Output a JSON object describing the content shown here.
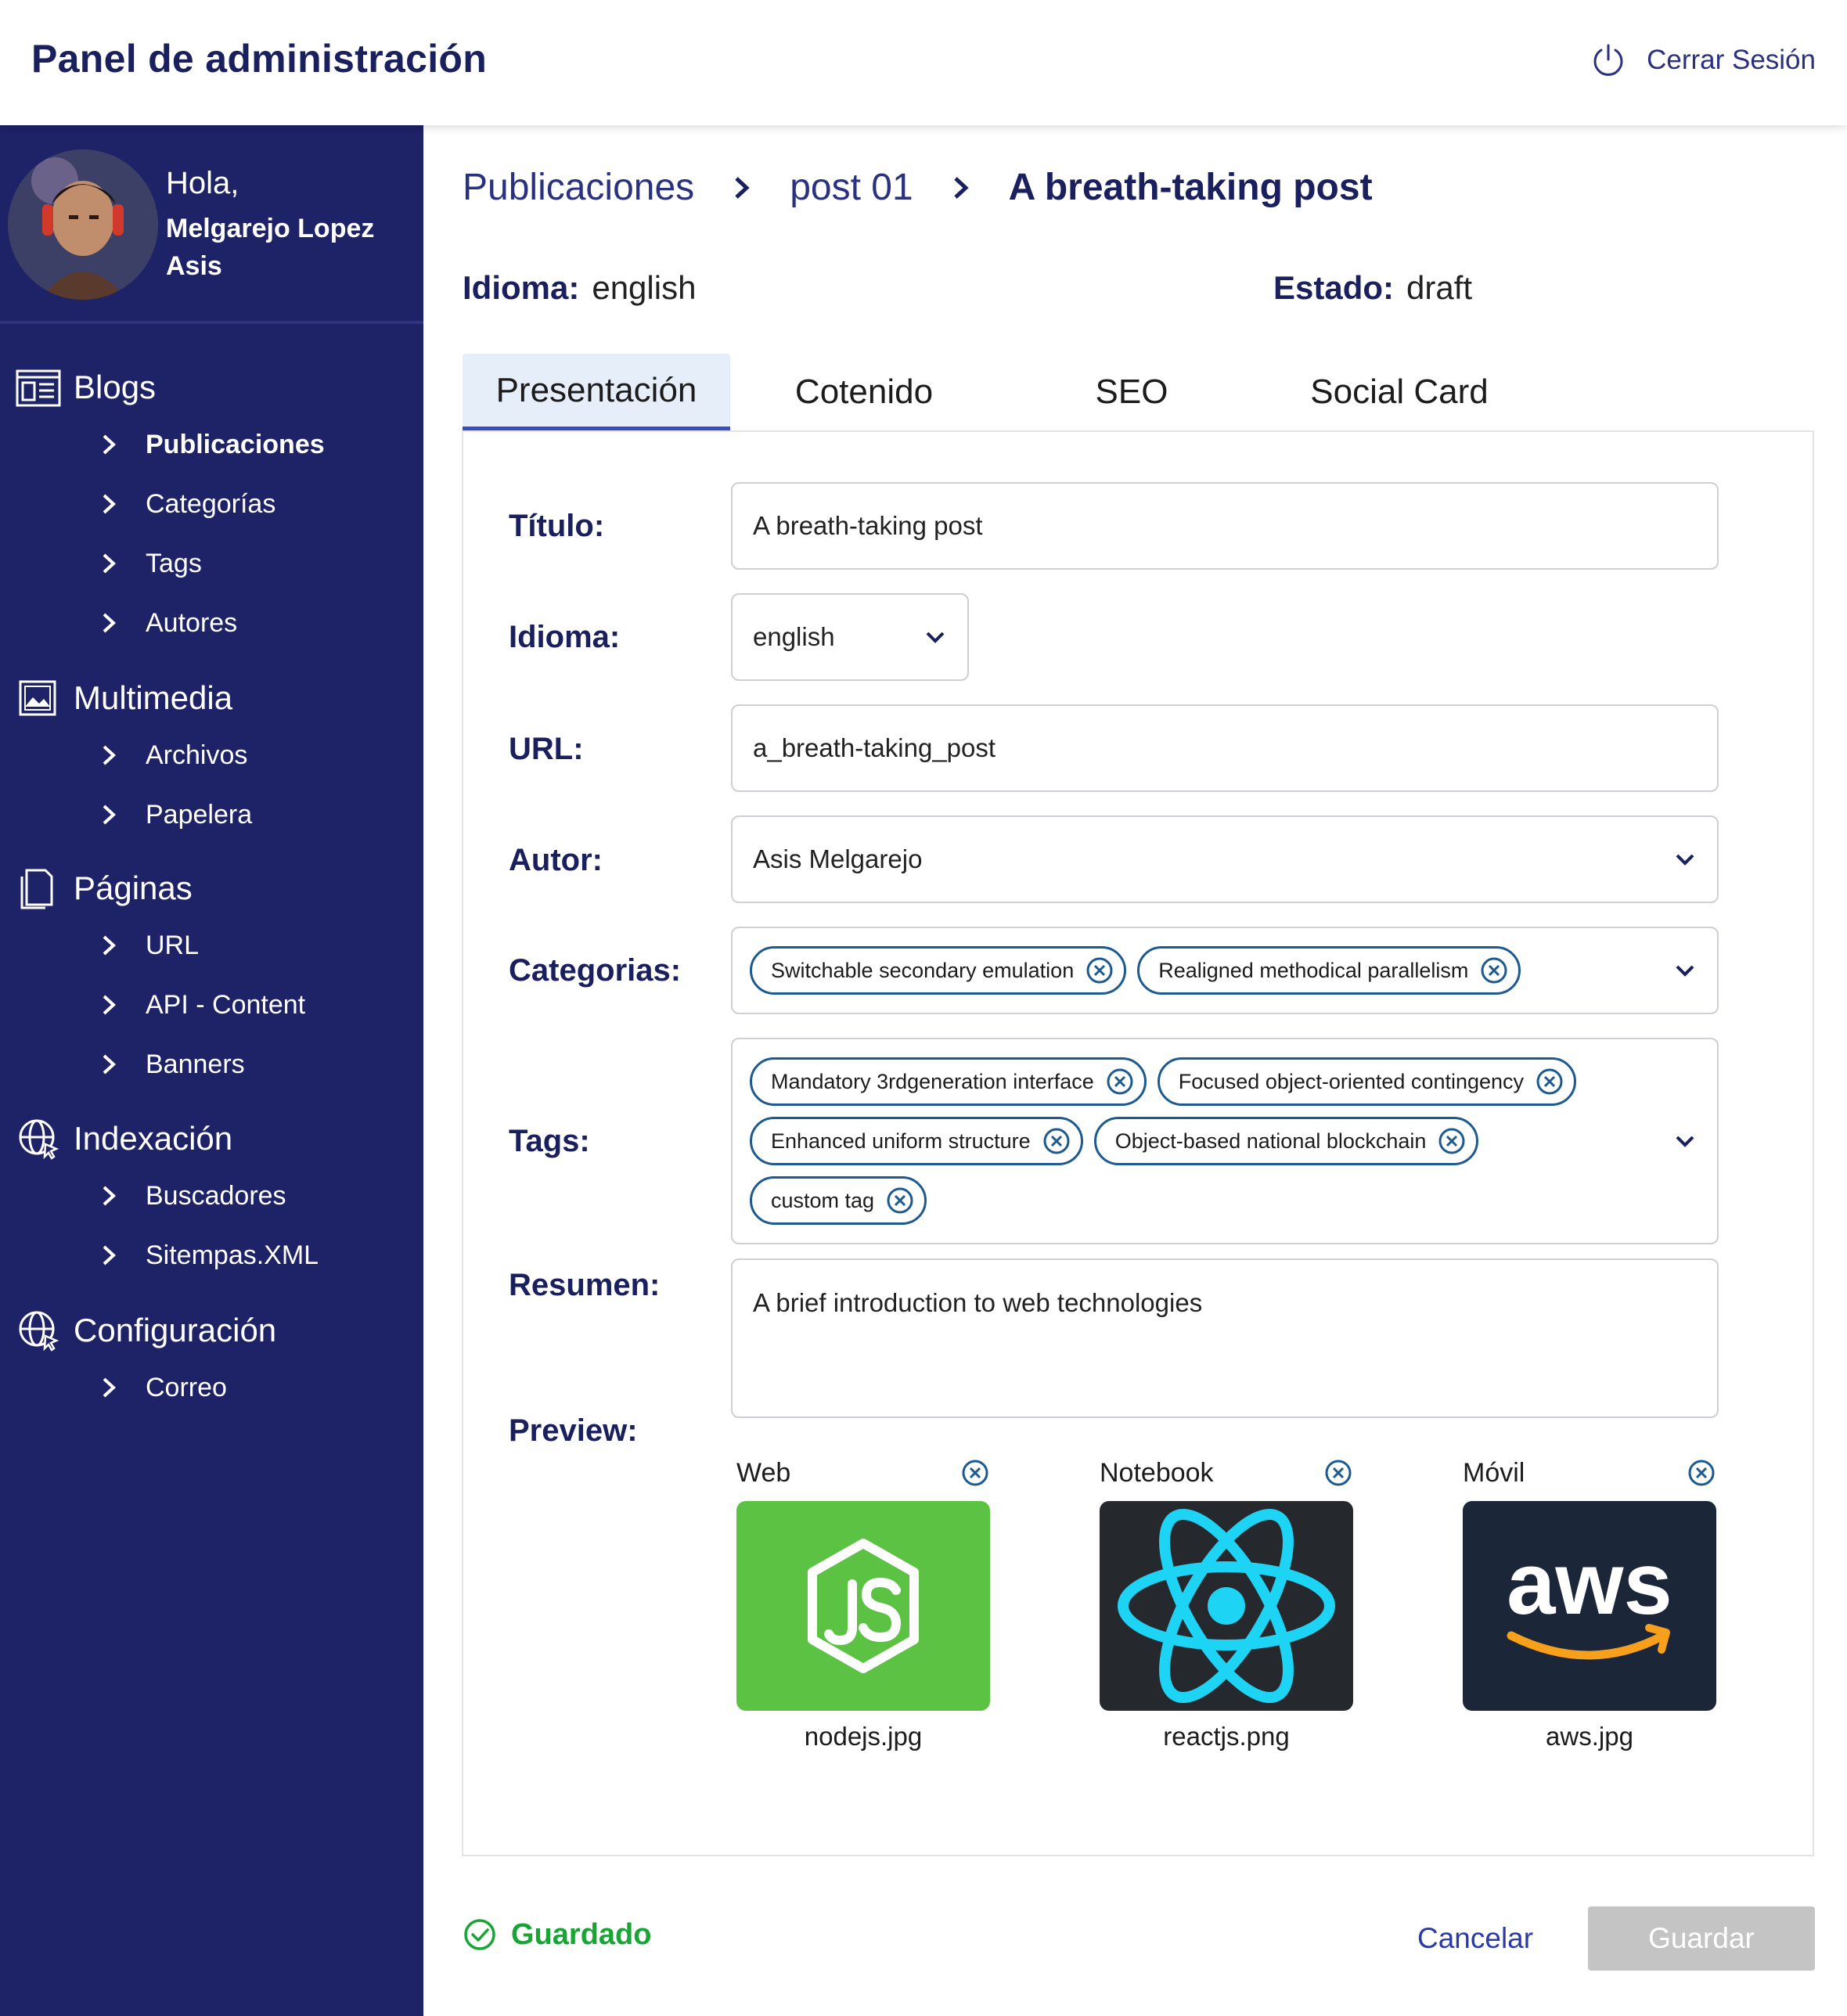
{
  "header": {
    "title": "Panel de administración",
    "logout_label": "Cerrar Sesión"
  },
  "profile": {
    "greeting": "Hola,",
    "name": "Melgarejo Lopez Asis"
  },
  "sidebar": {
    "sections": [
      {
        "label": "Blogs",
        "icon": "news-icon",
        "items": [
          "Publicaciones",
          "Categorías",
          "Tags",
          "Autores"
        ]
      },
      {
        "label": "Multimedia",
        "icon": "image-icon",
        "items": [
          "Archivos",
          "Papelera"
        ]
      },
      {
        "label": "Páginas",
        "icon": "pages-icon",
        "items": [
          "URL",
          "API - Content",
          "Banners"
        ]
      },
      {
        "label": "Indexación",
        "icon": "globe-icon",
        "items": [
          "Buscadores",
          "Sitempas.XML"
        ]
      },
      {
        "label": "Configuración",
        "icon": "globe-icon",
        "items": [
          "Correo"
        ]
      }
    ],
    "active_item": "Publicaciones"
  },
  "breadcrumb": [
    "Publicaciones",
    "post 01",
    "A breath-taking post"
  ],
  "meta": {
    "language_label": "Idioma:",
    "language_value": "english",
    "status_label": "Estado:",
    "status_value": "draft"
  },
  "tabs": [
    "Presentación",
    "Cotenido",
    "SEO",
    "Social Card"
  ],
  "active_tab": "Presentación",
  "form": {
    "title": {
      "label": "Título:",
      "value": "A breath-taking post"
    },
    "language": {
      "label": "Idioma:",
      "value": "english"
    },
    "url": {
      "label": "URL:",
      "value": "a_breath-taking_post"
    },
    "author": {
      "label": "Autor:",
      "value": "Asis Melgarejo"
    },
    "categories": {
      "label": "Categorias:",
      "chips": [
        "Switchable secondary emulation",
        "Realigned methodical parallelism"
      ]
    },
    "tags": {
      "label": "Tags:",
      "chips": [
        "Mandatory 3rdgeneration interface",
        "Focused object-oriented contingency",
        "Enhanced uniform structure",
        "Object-based national blockchain",
        "custom tag"
      ]
    },
    "summary": {
      "label": "Resumen:",
      "value": "A brief introduction to web technologies"
    },
    "preview": {
      "label": "Preview:",
      "items": [
        {
          "device": "Web",
          "file": "nodejs.jpg",
          "logo": "nodejs-logo",
          "bg": "#5cc244"
        },
        {
          "device": "Notebook",
          "file": "reactjs.png",
          "logo": "react-logo",
          "bg": "#25292e"
        },
        {
          "device": "Móvil",
          "file": "aws.jpg",
          "logo": "aws-logo",
          "bg": "#1b2639"
        }
      ]
    }
  },
  "footer": {
    "saved_label": "Guardado",
    "cancel_label": "Cancelar",
    "save_label": "Guardar"
  },
  "colors": {
    "sidebar": "#1e2266",
    "accent": "#1a1f5e",
    "chip_border": "#1c5a8f",
    "success": "#19a536",
    "link": "#2a3ba8",
    "disabled_button": "#c4c4c4"
  },
  "preview_logo_text": {
    "aws": "aws"
  }
}
